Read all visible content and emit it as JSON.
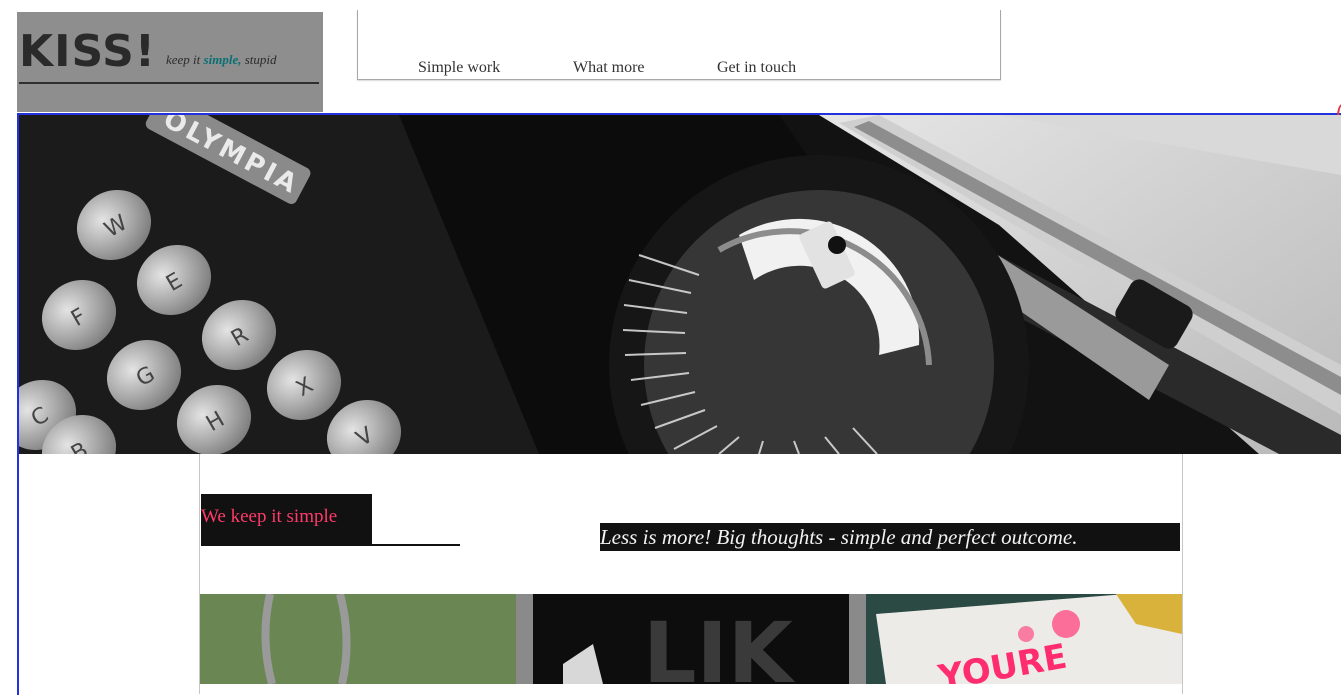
{
  "header": {
    "logo": "KISS!",
    "tagline": {
      "before": "keep it ",
      "accent": "simple,",
      "after": " stupid"
    },
    "nav": [
      {
        "label": "Simple work"
      },
      {
        "label": "What more"
      },
      {
        "label": "Get in touch"
      }
    ]
  },
  "hero": {
    "brand_on_typewriter": "OLYMPIA",
    "key_letters": [
      "W",
      "E",
      "R",
      "F",
      "G",
      "H",
      "X",
      "C",
      "V",
      "B"
    ]
  },
  "content": {
    "headline": "We keep it simple",
    "slogan": "Less is more! Big thoughts - simple and perfect outcome."
  },
  "thumbnails": [
    {
      "name": "thumbnail-green",
      "text": ""
    },
    {
      "name": "thumbnail-dark",
      "text": "LIK"
    },
    {
      "name": "thumbnail-pink",
      "text": "YOURE"
    }
  ],
  "colors": {
    "accent_headline": "#ff3a6a",
    "tagline_accent": "#0b6f73",
    "frame_border": "#2233dd",
    "logo_block": "#8e8e8e"
  }
}
